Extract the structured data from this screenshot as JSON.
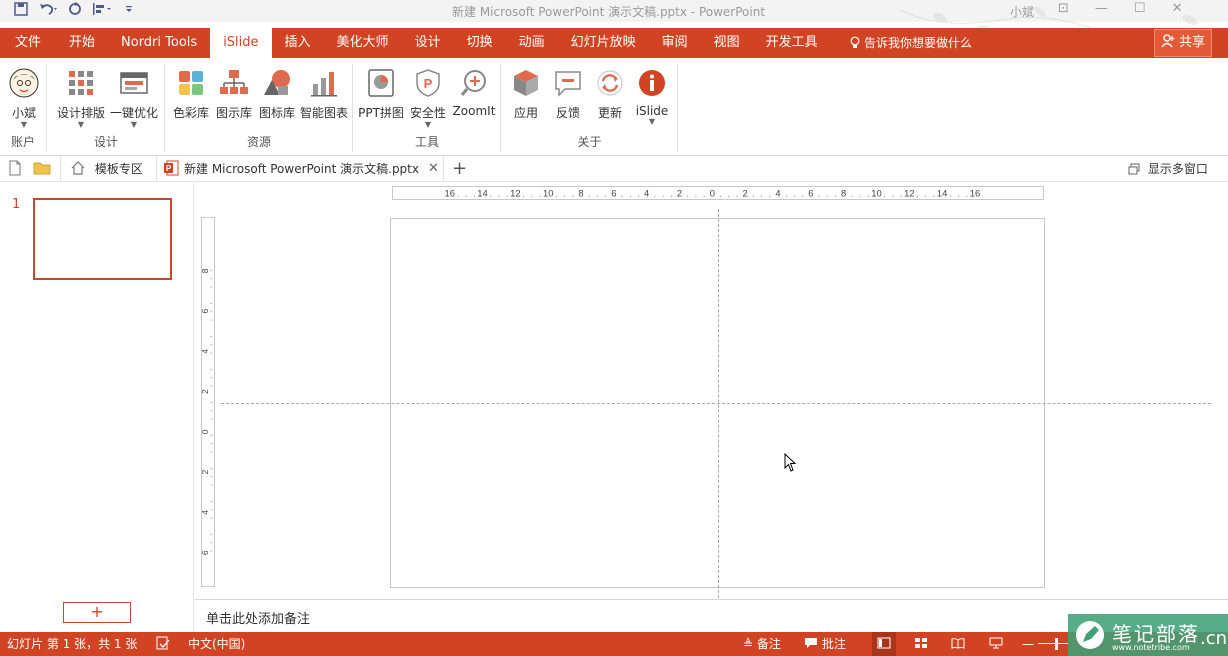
{
  "titlebar": {
    "title": "新建 Microsoft PowerPoint 演示文稿.pptx  -  PowerPoint",
    "user": "小斌"
  },
  "ribbon_tabs": {
    "file": "文件",
    "tabs": [
      "开始",
      "Nordri Tools",
      "iSlide",
      "插入",
      "美化大师",
      "设计",
      "切换",
      "动画",
      "幻灯片放映",
      "审阅",
      "视图",
      "开发工具"
    ],
    "active": "iSlide",
    "tell_me": "告诉我你想要做什么",
    "share": "共享"
  },
  "groups": {
    "account": {
      "label": "账户",
      "user_button": "小斌"
    },
    "design": {
      "label": "设计",
      "b1": "设计排版",
      "b2": "一键优化"
    },
    "resources": {
      "label": "资源",
      "b1": "色彩库",
      "b2": "图示库",
      "b3": "图标库",
      "b4": "智能图表"
    },
    "tools": {
      "label": "工具",
      "b1": "PPT拼图",
      "b2": "安全性",
      "b3": "ZoomIt"
    },
    "about": {
      "label": "关于",
      "b1": "应用",
      "b2": "反馈",
      "b3": "更新",
      "b4": "iSlide"
    }
  },
  "doc_strip": {
    "templates": "模板专区",
    "doc_tab": "新建 Microsoft PowerPoint 演示文稿.pptx",
    "multi_window": "显示多窗口"
  },
  "thumbnails": {
    "slide_number": "1",
    "add": "+"
  },
  "ruler": {
    "h_ticks": [
      "16",
      "14",
      "12",
      "10",
      "8",
      "6",
      "4",
      "2",
      "0",
      "2",
      "4",
      "6",
      "8",
      "10",
      "12",
      "14",
      "16"
    ],
    "v_ticks": [
      "8",
      "6",
      "4",
      "2",
      "0",
      "2",
      "4",
      "6",
      "8"
    ]
  },
  "notes": {
    "placeholder": "单击此处添加备注"
  },
  "status": {
    "slide_info": "幻灯片 第 1 张，共 1 张",
    "language": "中文(中国)",
    "notes": "备注",
    "comments": "批注"
  },
  "watermark": {
    "text": "笔记部落",
    "url": "www.notetribe.com",
    "cn": ".cn"
  },
  "colors": {
    "accent": "#d04423",
    "watermark": "#40a078"
  }
}
